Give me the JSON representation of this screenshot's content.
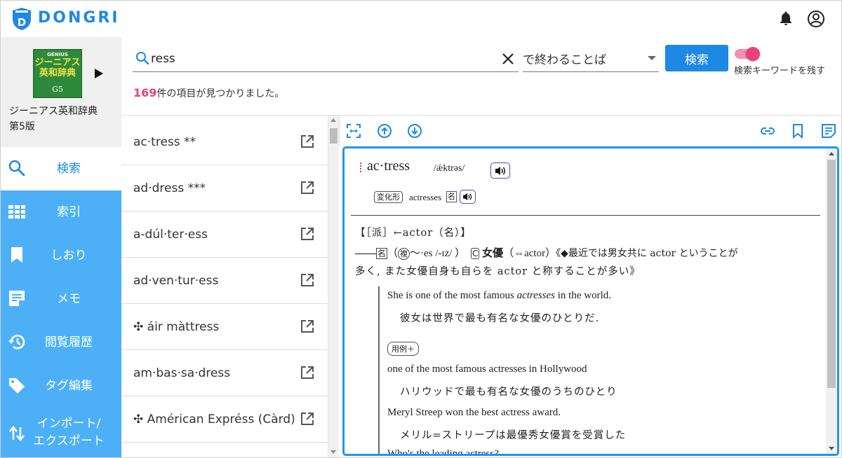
{
  "app": {
    "brand": "DONGRI",
    "brand_color": "#1e88e5"
  },
  "header": {
    "icons": [
      "notification-bell-icon",
      "account-circle-icon"
    ]
  },
  "dictionary": {
    "cover": {
      "publisher_mark": "GENIUS",
      "title_line1": "ジーニアス",
      "title_line2": "英和辞典",
      "edition_mark": "G5"
    },
    "name_line1": "ジーニアス英和辞典",
    "name_line2": "第5版"
  },
  "sidebar": {
    "active": {
      "label": "検索",
      "icon": "search-icon"
    },
    "items": [
      {
        "label": "索引",
        "icon": "grid-icon"
      },
      {
        "label": "しおり",
        "icon": "bookmark-icon"
      },
      {
        "label": "メモ",
        "icon": "memo-icon"
      },
      {
        "label": "閲覧履歴",
        "icon": "history-icon"
      },
      {
        "label": "タグ編集",
        "icon": "tag-icon"
      },
      {
        "label_line1": "インポート/",
        "label_line2": "エクスポート",
        "icon": "import-export-icon"
      }
    ],
    "bg_color": "#4db0f7"
  },
  "search": {
    "query": "ress",
    "mode": "で終わることば",
    "button_label": "検索",
    "keep_keyword_label": "検索キーワードを残す",
    "keep_keyword_on": true,
    "result_count": "169",
    "result_suffix": "件の項目が見つかりました。"
  },
  "results": [
    {
      "text": "ac·tress **"
    },
    {
      "text": "ad·dress ***"
    },
    {
      "text": "a-dúl·ter·ess"
    },
    {
      "text": "ad·ven·tur·ess"
    },
    {
      "text": "✣ áir màttress"
    },
    {
      "text": "am·bas·sa·dress"
    },
    {
      "text": "✣ Américan Expréss (Càrd)"
    }
  ],
  "detail_toolbar": {
    "left_icons": [
      "fit-screen-icon",
      "arrow-up-circle-icon",
      "arrow-down-circle-icon"
    ],
    "right_icons": [
      "link-icon",
      "bookmark-outline-icon",
      "note-icon"
    ]
  },
  "entry": {
    "headword": "ac·tress",
    "pronunciation": "/ǽktrəs/",
    "conjugation_label": "変化形",
    "conjugation_form": "actresses",
    "conjugation_pos": "名",
    "derivation": "【［派］←actor（名）】",
    "sense_prefix": "——",
    "sense_pos": "名",
    "plural_open": "（",
    "plural_mark": "複",
    "plural_text": "～·es /-ɪz/ ）",
    "countable": "C",
    "gloss": "女優",
    "antonym": "（⇔actor）",
    "note_line1": "《◆最近では男女共に actor ということが",
    "note_line2": "多く, また女優自身も自らを actor と称することが多い》",
    "examples": [
      {
        "en_pre": "She is one of the most famous ",
        "en_em": "actresses",
        "en_post": " in the world.",
        "ja": "彼女は世界で最も有名な女優のひとりだ."
      }
    ],
    "more_examples_label": "用例＋",
    "more": [
      {
        "en": "one of the most famous actresses in Hollywood",
        "ja": "ハリウッドで最も有名な女優のうちのひとり"
      },
      {
        "en": "Meryl Streep won the best actress award.",
        "ja": "メリル=ストリープは最優秀女優賞を受賞した"
      },
      {
        "en": "Who's the leading actress?"
      }
    ]
  }
}
